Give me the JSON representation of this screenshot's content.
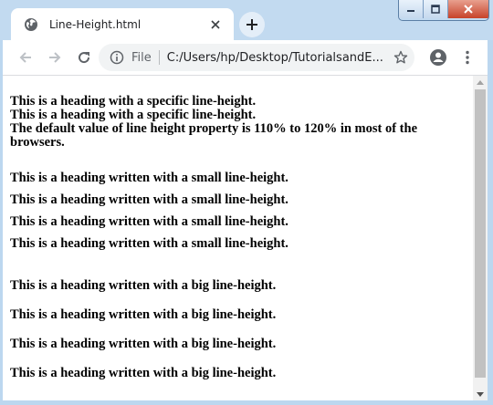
{
  "browser": {
    "tab_title": "Line-Height.html",
    "tab_icon": "globe-icon",
    "address_prefix": "File",
    "address_url": "C:/Users/hp/Desktop/TutorialsandE..."
  },
  "page": {
    "specific_headings": [
      "This is a heading with a specific line-height.",
      "This is a heading with a specific line-height.",
      "The default value of line height property is 110% to 120% in most of the browsers."
    ],
    "small_headings": [
      "This is a heading written with a small line-height.",
      "This is a heading written with a small line-height.",
      "This is a heading written with a small line-height.",
      "This is a heading written with a small line-height."
    ],
    "big_headings": [
      "This is a heading written with a big line-height.",
      "This is a heading written with a big line-height.",
      "This is a heading written with a big line-height.",
      "This is a heading written with a big line-height."
    ]
  },
  "colors": {
    "frame": "#bcd7ef",
    "close_button": "#c7432a"
  }
}
